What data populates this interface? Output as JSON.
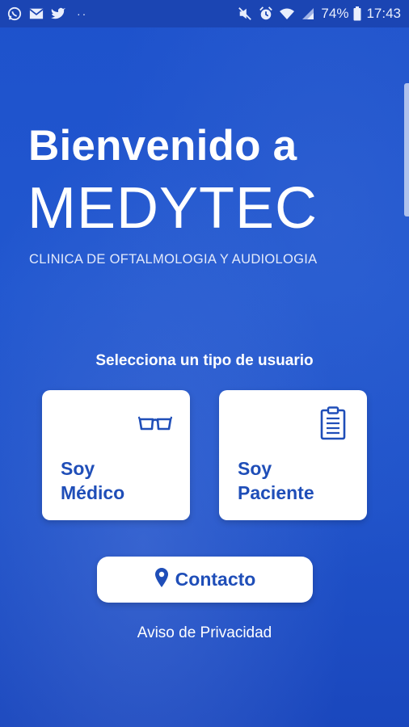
{
  "status_bar": {
    "left_icons": [
      "whatsapp-icon",
      "mail-icon",
      "twitter-icon"
    ],
    "more_indicator": "··",
    "right_icons": [
      "mute-icon",
      "alarm-icon",
      "wifi-icon",
      "signal-icon"
    ],
    "battery_percent": "74%",
    "time": "17:43"
  },
  "welcome": {
    "title_line1": "Bienvenido a",
    "brand": "MEDYTEC",
    "tagline": "CLINICA DE OFTALMOLOGIA Y AUDIOLOGIA"
  },
  "user_type": {
    "prompt": "Selecciona un tipo de usuario",
    "cards": [
      {
        "line1": "Soy",
        "line2": "Médico",
        "icon": "glasses-icon"
      },
      {
        "line1": "Soy",
        "line2": "Paciente",
        "icon": "clipboard-icon"
      }
    ]
  },
  "contact": {
    "label": "Contacto",
    "icon": "location-pin-icon"
  },
  "privacy": {
    "label": "Aviso de Privacidad"
  },
  "colors": {
    "background": "#1f52c9",
    "status_bar": "#1b45b3",
    "card": "#ffffff",
    "accent_text": "#1f4eb8"
  }
}
